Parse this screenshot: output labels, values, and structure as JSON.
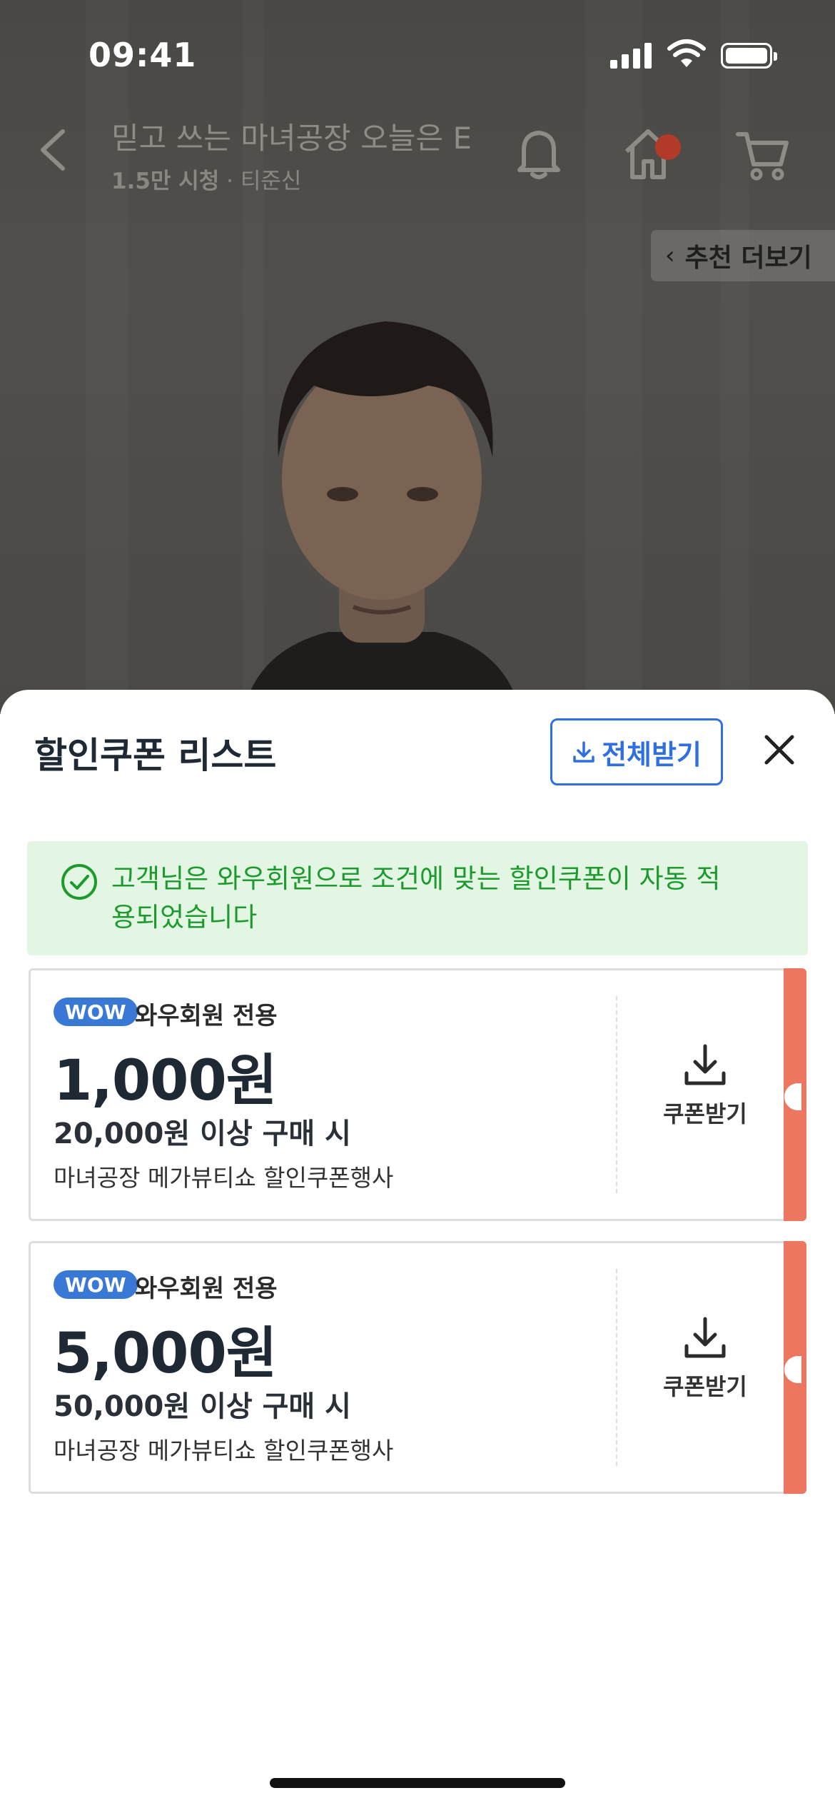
{
  "status_bar": {
    "time": "09:41"
  },
  "live": {
    "title": "믿고 쓰는 마녀공장 오늘은 E",
    "views": "1.5만 시청",
    "separator": "·",
    "host": "티준신",
    "more_button": "추천 더보기"
  },
  "icons": {
    "back": "chevron-left-icon",
    "bell": "bell-icon",
    "home": "home-icon",
    "cart": "cart-icon",
    "close": "close-icon",
    "download": "download-icon",
    "check": "check-circle-icon"
  },
  "sheet": {
    "title": "할인쿠폰 리스트",
    "download_all": "전체받기",
    "notice": "고객님은 와우회원으로 조건에 맞는 할인쿠폰이 자동 적용되었습니다"
  },
  "coupons": [
    {
      "badge": "WOW",
      "member_label": "와우회원 전용",
      "amount": "1,000원",
      "condition": "20,000원 이상 구매 시",
      "description": "마녀공장 메가뷰티쇼 할인쿠폰행사",
      "action": "쿠폰받기"
    },
    {
      "badge": "WOW",
      "member_label": "와우회원 전용",
      "amount": "5,000원",
      "condition": "50,000원 이상 구매 시",
      "description": "마녀공장 메가뷰티쇼 할인쿠폰행사",
      "action": "쿠폰받기"
    }
  ],
  "colors": {
    "accent_blue": "#2f6fe0",
    "wow_badge": "#3a78d6",
    "notice_bg": "#e3f6e3",
    "notice_text": "#1d9a2e",
    "coupon_stripe": "#ec7660",
    "title_text": "#1f2933"
  }
}
